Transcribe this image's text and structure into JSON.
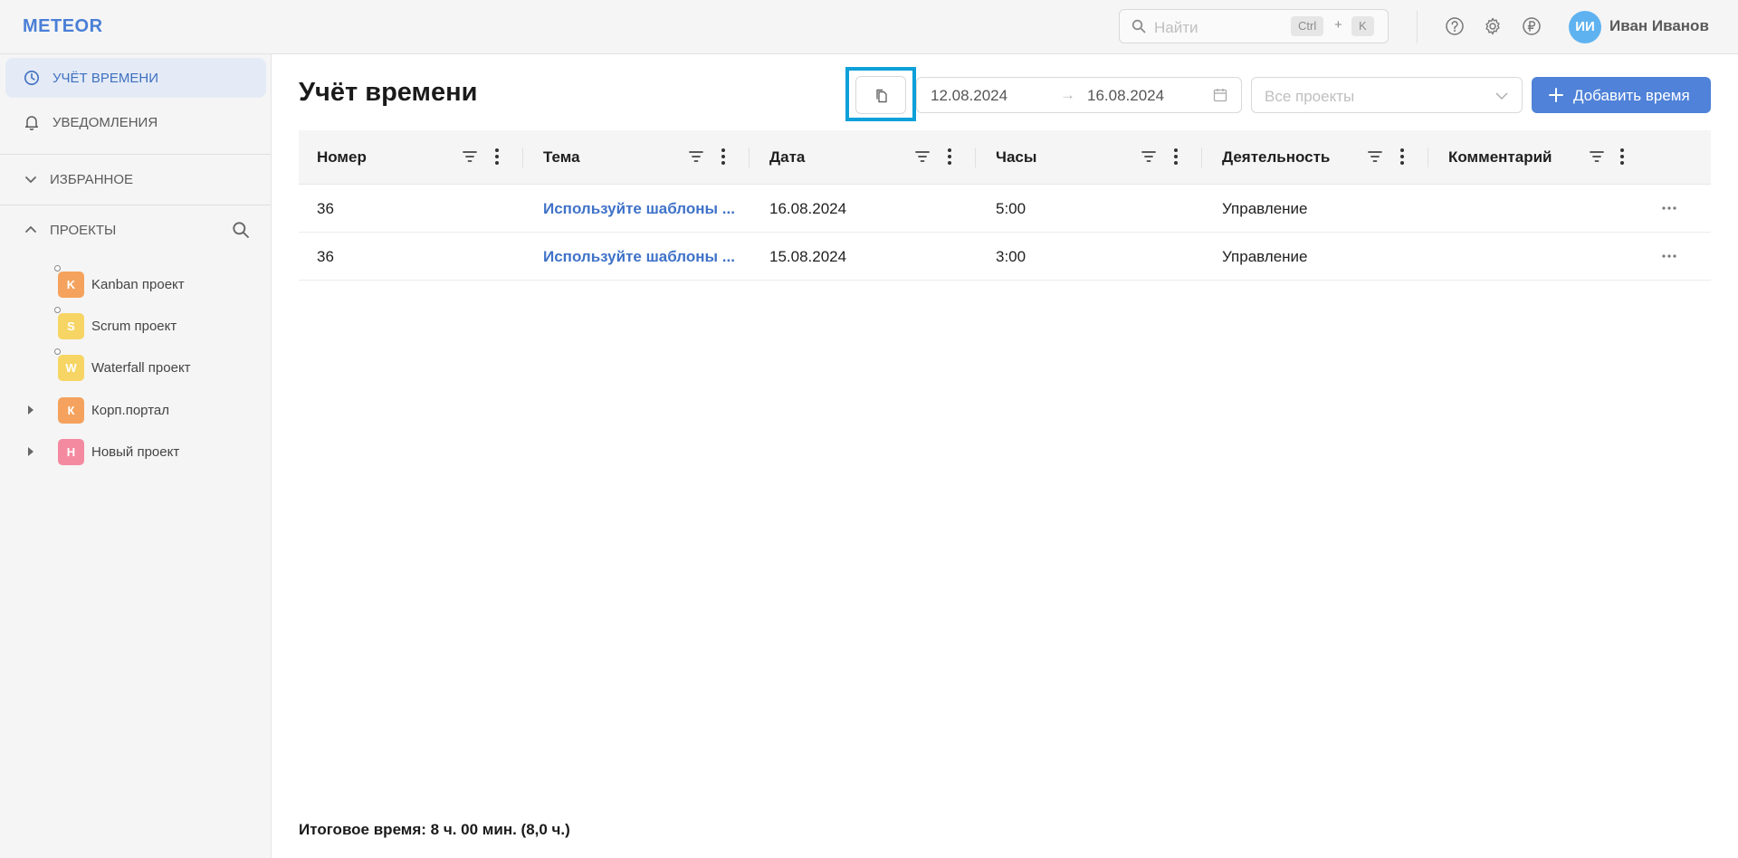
{
  "app": {
    "logo": "METEOR"
  },
  "header": {
    "search_placeholder": "Найти",
    "shortcut_ctrl": "Ctrl",
    "shortcut_plus": "+",
    "shortcut_key": "K",
    "user_initials": "ИИ",
    "user_name": "Иван Иванов"
  },
  "sidebar": {
    "nav": [
      {
        "label": "УЧЁТ ВРЕМЕНИ",
        "icon": "clock-icon",
        "active": true
      },
      {
        "label": "УВЕДОМЛЕНИЯ",
        "icon": "bell-icon",
        "active": false
      }
    ],
    "favorites_label": "ИЗБРАННОЕ",
    "projects_label": "ПРОЕКТЫ",
    "projects": [
      {
        "letter": "K",
        "name": "Kanban проект",
        "color": "#f4a25d"
      },
      {
        "letter": "S",
        "name": "Scrum проект",
        "color": "#f7d564"
      },
      {
        "letter": "W",
        "name": "Waterfall проект",
        "color": "#f7d564"
      },
      {
        "letter": "К",
        "name": "Корп.портал",
        "color": "#f4a25d"
      },
      {
        "letter": "Н",
        "name": "Новый проект",
        "color": "#f38aa0"
      }
    ]
  },
  "main": {
    "title": "Учёт времени",
    "date_from": "12.08.2024",
    "date_arrow": "→",
    "date_to": "16.08.2024",
    "projects_placeholder": "Все проекты",
    "add_button": "Добавить время",
    "columns": [
      "Номер",
      "Тема",
      "Дата",
      "Часы",
      "Деятельность",
      "Комментарий"
    ],
    "rows": [
      {
        "number": "36",
        "topic": "Используйте шаблоны ...",
        "date": "16.08.2024",
        "hours": "5:00",
        "activity": "Управление",
        "comment": ""
      },
      {
        "number": "36",
        "topic": "Используйте шаблоны ...",
        "date": "15.08.2024",
        "hours": "3:00",
        "activity": "Управление",
        "comment": ""
      }
    ],
    "total": "Итоговое время: 8 ч. 00 мин. (8,0 ч.)"
  },
  "colors": {
    "accent": "#4f82d8",
    "link": "#3f72c8",
    "highlight": "#0ea0d8"
  }
}
